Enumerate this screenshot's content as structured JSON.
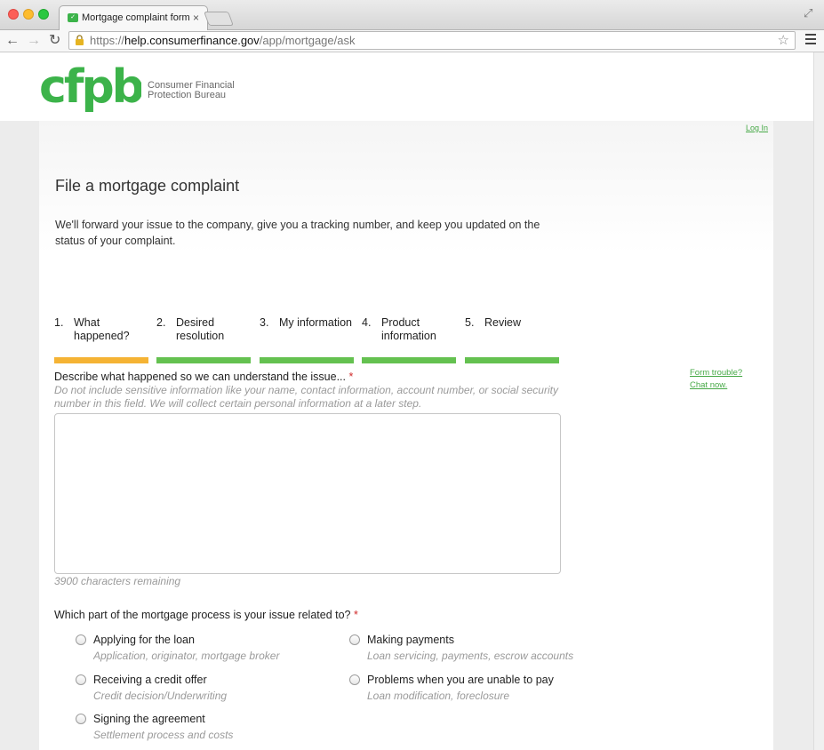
{
  "browser": {
    "tab_title": "Mortgage complaint form",
    "tab_close": "×",
    "url_scheme": "https://",
    "url_host": "help.consumerfinance.gov",
    "url_path": "/app/mortgage/ask",
    "icons": [
      "lock-icon",
      "star-icon",
      "menu-icon",
      "back-icon",
      "forward-icon",
      "reload-icon"
    ]
  },
  "header": {
    "logo_text": "cfpb",
    "org_line1": "Consumer Financial",
    "org_line2": "Protection Bureau",
    "brand_color": "#3cb34a"
  },
  "content": {
    "login_link": "Log In",
    "title": "File a mortgage complaint",
    "intro": "We'll forward your issue to the company, give you a tracking number, and keep you updated on the status of your complaint.",
    "steps": [
      {
        "num": "1.",
        "label": "What happened?",
        "status": "active"
      },
      {
        "num": "2.",
        "label": "Desired resolution",
        "status": "incomplete"
      },
      {
        "num": "3.",
        "label": "My information",
        "status": "incomplete"
      },
      {
        "num": "4.",
        "label": "Product information",
        "status": "incomplete"
      },
      {
        "num": "5.",
        "label": "Review",
        "status": "incomplete"
      }
    ],
    "step_colors": {
      "active": "#f5b334",
      "incomplete": "#64c150"
    },
    "side_links": {
      "form_trouble": "Form trouble?",
      "chat_now": "Chat now."
    },
    "question1": {
      "label": "Describe what happened so we can understand the issue...",
      "required_mark": "*",
      "hint": "Do not include sensitive information like your name, contact information, account number, or social security number in this field. We will collect certain personal information at a later step.",
      "value": "",
      "chars_remaining": "3900 characters remaining"
    },
    "question2": {
      "label": "Which part of the mortgage process is your issue related to?",
      "required_mark": "*",
      "options": [
        {
          "label": "Applying for the loan",
          "sub": "Application, originator, mortgage broker"
        },
        {
          "label": "Making payments",
          "sub": "Loan servicing, payments, escrow accounts"
        },
        {
          "label": "Receiving a credit offer",
          "sub": "Credit decision/Underwriting"
        },
        {
          "label": "Problems when you are unable to pay",
          "sub": "Loan modification, foreclosure"
        },
        {
          "label": "Signing the agreement",
          "sub": "Settlement process and costs"
        }
      ]
    }
  }
}
